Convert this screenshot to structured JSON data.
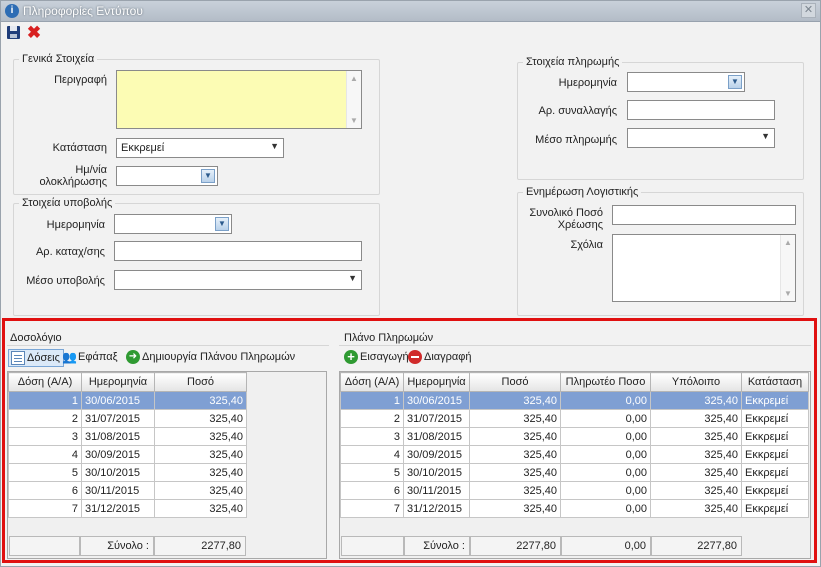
{
  "window": {
    "title": "Πληροφορίες Εντύπου",
    "close_glyph": "✕"
  },
  "toolbar": {
    "save_icon": "save-disk-icon",
    "cancel_glyph": "✖"
  },
  "general": {
    "legend": "Γενικά Στοιχεία",
    "description_label": "Περιγραφή",
    "description_value": "",
    "status_label": "Κατάσταση",
    "status_value": "Εκκρεμεί",
    "completion_label_1": "Ημ/νία",
    "completion_label_2": "ολοκλήρωσης",
    "completion_value": ""
  },
  "submission": {
    "legend": "Στοιχεία υποβολής",
    "date_label": "Ημερομηνία",
    "date_value": "",
    "reg_label": "Αρ. καταχ/σης",
    "reg_value": "",
    "method_label": "Μέσο υποβολής",
    "method_value": ""
  },
  "payment": {
    "legend": "Στοιχεία πληρωμής",
    "date_label": "Ημερομηνία",
    "date_value": "",
    "txn_label": "Αρ. συναλλαγής",
    "txn_value": "",
    "method_label": "Μέσο πληρωμής",
    "method_value": ""
  },
  "accounting": {
    "legend": "Ενημέρωση Λογιστικής",
    "total_label_1": "Συνολικό Ποσό",
    "total_label_2": "Χρέωσης",
    "total_value": "",
    "comments_label": "Σχόλια",
    "comments_value": ""
  },
  "dosologio": {
    "title": "Δοσολόγιο",
    "tabs": {
      "doseis": "Δόσεις",
      "efapax": "Εφάπαξ",
      "create_plan": "Δημιουργία Πλάνου Πληρωμών"
    },
    "columns": [
      "Δόση (Α/Α)",
      "Ημερομηνία",
      "Ποσό"
    ],
    "rows": [
      {
        "no": "1",
        "date": "30/06/2015",
        "amount": "325,40"
      },
      {
        "no": "2",
        "date": "31/07/2015",
        "amount": "325,40"
      },
      {
        "no": "3",
        "date": "31/08/2015",
        "amount": "325,40"
      },
      {
        "no": "4",
        "date": "30/09/2015",
        "amount": "325,40"
      },
      {
        "no": "5",
        "date": "30/10/2015",
        "amount": "325,40"
      },
      {
        "no": "6",
        "date": "30/11/2015",
        "amount": "325,40"
      },
      {
        "no": "7",
        "date": "31/12/2015",
        "amount": "325,40"
      }
    ],
    "selected_row": 0,
    "total_label": "Σύνολο :",
    "total_amount": "2277,80"
  },
  "plan": {
    "title": "Πλάνο Πληρωμών",
    "insert_label": "Εισαγωγή",
    "delete_label": "Διαγραφή",
    "columns": [
      "Δόση (Α/Α)",
      "Ημερομηνία",
      "Ποσό",
      "Πληρωτέο Ποσο",
      "Υπόλοιπο",
      "Κατάσταση"
    ],
    "rows": [
      {
        "no": "1",
        "date": "30/06/2015",
        "amount": "325,40",
        "paid": "0,00",
        "balance": "325,40",
        "status": "Εκκρεμεί"
      },
      {
        "no": "2",
        "date": "31/07/2015",
        "amount": "325,40",
        "paid": "0,00",
        "balance": "325,40",
        "status": "Εκκρεμεί"
      },
      {
        "no": "3",
        "date": "31/08/2015",
        "amount": "325,40",
        "paid": "0,00",
        "balance": "325,40",
        "status": "Εκκρεμεί"
      },
      {
        "no": "4",
        "date": "30/09/2015",
        "amount": "325,40",
        "paid": "0,00",
        "balance": "325,40",
        "status": "Εκκρεμεί"
      },
      {
        "no": "5",
        "date": "30/10/2015",
        "amount": "325,40",
        "paid": "0,00",
        "balance": "325,40",
        "status": "Εκκρεμεί"
      },
      {
        "no": "6",
        "date": "30/11/2015",
        "amount": "325,40",
        "paid": "0,00",
        "balance": "325,40",
        "status": "Εκκρεμεί"
      },
      {
        "no": "7",
        "date": "31/12/2015",
        "amount": "325,40",
        "paid": "0,00",
        "balance": "325,40",
        "status": "Εκκρεμεί"
      }
    ],
    "selected_row": 0,
    "total_label": "Σύνολο :",
    "total_amount": "2277,80",
    "total_paid": "0,00",
    "total_balance": "2277,80"
  },
  "colors": {
    "highlight": "#e01010",
    "selected_row": "#7f9fd3",
    "description_bg": "#fcfcb4"
  }
}
